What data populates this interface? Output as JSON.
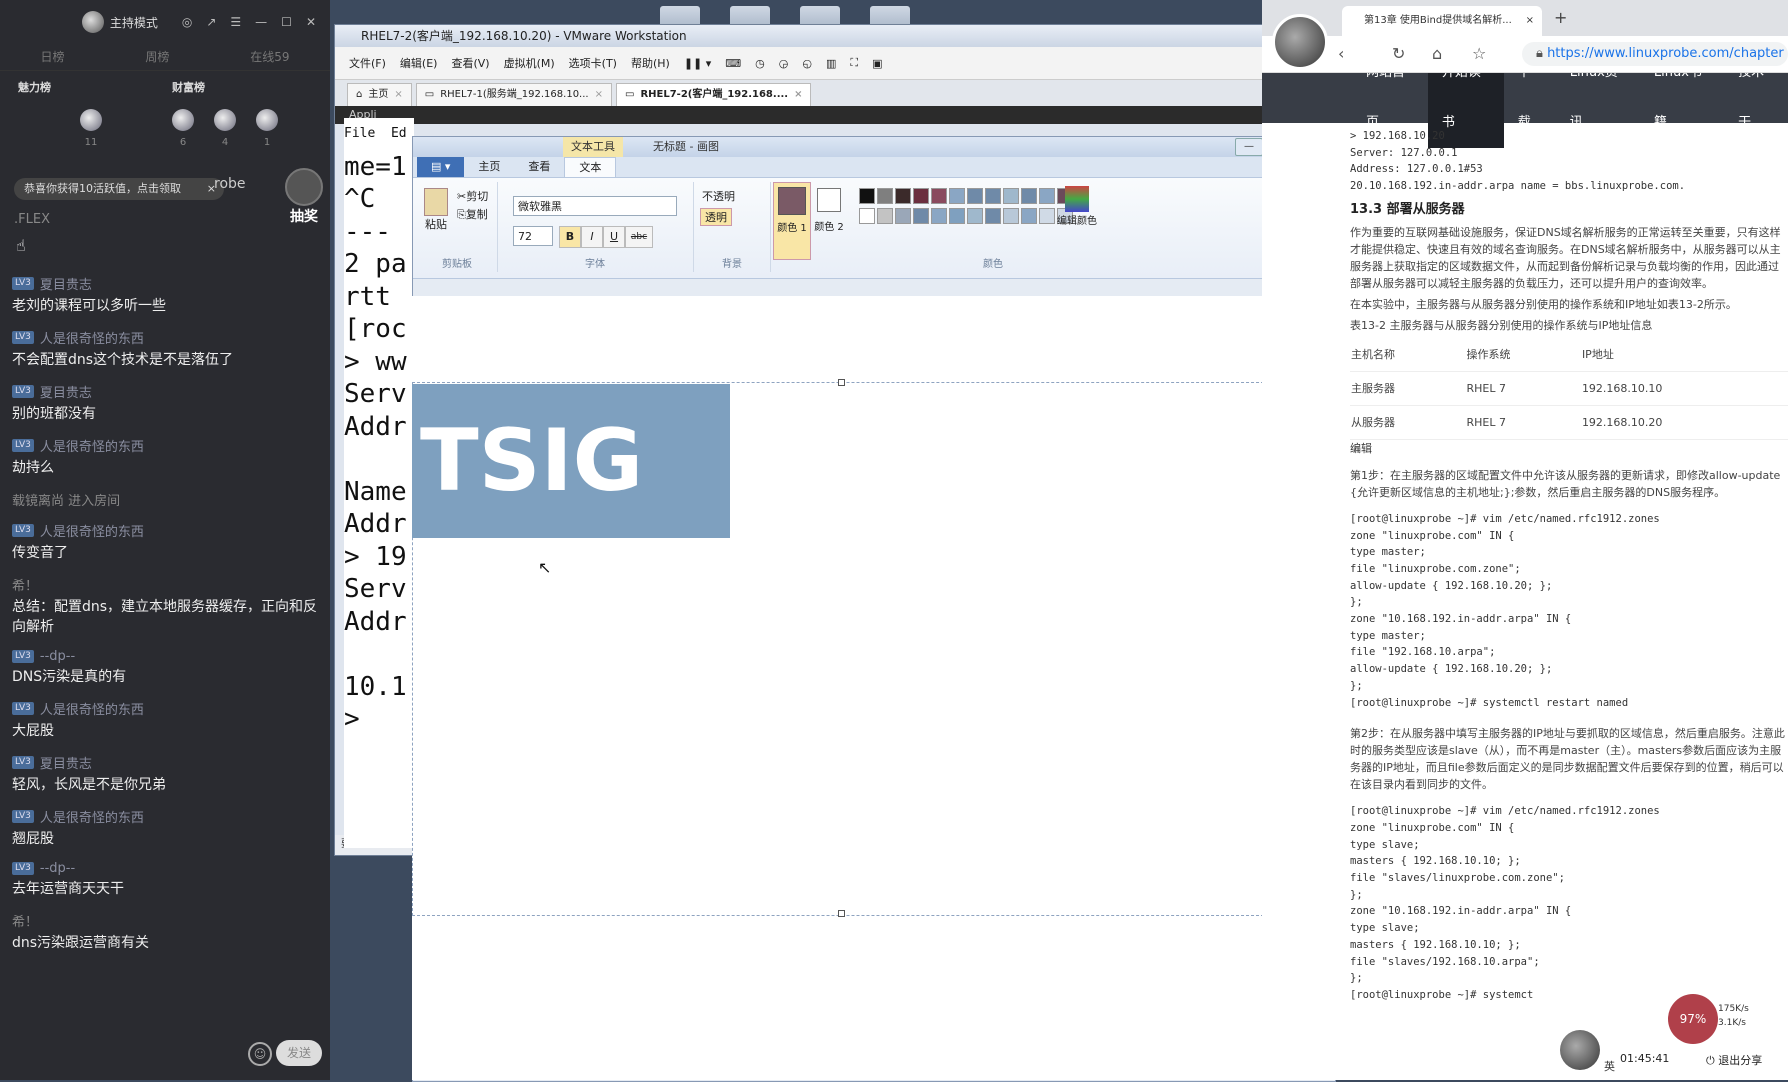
{
  "chat": {
    "host_label": "主持模式",
    "tabs": [
      "日榜",
      "周榜",
      "在线59"
    ],
    "rank_left_title": "魅力榜",
    "rank_right_title": "财富榜",
    "rank_icons": [
      {
        "count": "11"
      },
      {
        "count": "6"
      },
      {
        "count": "4"
      },
      {
        "count": "1"
      }
    ],
    "toast": "恭喜你获得10活跃值，点击领取",
    "toast_close": "×",
    "probe_text": "robe",
    "lottery": "抽奖",
    "flex_text": ".FLEX",
    "messages": [
      {
        "user": "夏目贵志",
        "lv": "LV3",
        "text": "老刘的课程可以多听一些"
      },
      {
        "user": "人是很奇怪的东西",
        "lv": "LV3",
        "text": "不会配置dns这个技术是不是落伍了"
      },
      {
        "user": "夏目贵志",
        "lv": "LV3",
        "text": "别的班都没有"
      },
      {
        "user": "人是很奇怪的东西",
        "lv": "LV3",
        "text": "劫持么"
      },
      {
        "user": "载镜离尚 进入房间",
        "lv": "",
        "text": ""
      },
      {
        "user": "人是很奇怪的东西",
        "lv": "LV3",
        "text": "传变音了"
      },
      {
        "user": "希！",
        "lv": "",
        "text": "总结：配置dns，建立本地服务器缓存，正向和反向解析"
      },
      {
        "user": "--dp--",
        "lv": "LV3",
        "text": "DNS污染是真的有"
      },
      {
        "user": "人是很奇怪的东西",
        "lv": "LV3",
        "text": "大屁股"
      },
      {
        "user": "夏目贵志",
        "lv": "LV3",
        "text": "轻风，长风是不是你兄弟"
      },
      {
        "user": "人是很奇怪的东西",
        "lv": "LV3",
        "text": "翘屁股"
      },
      {
        "user": "--dp--",
        "lv": "LV3",
        "text": "去年运营商天天干"
      },
      {
        "user": "希！",
        "lv": "",
        "text": "dns污染跟运营商有关"
      }
    ],
    "send_label": "发送"
  },
  "vmware": {
    "title": "RHEL7-2(客户端_192.168.10.20) - VMware Workstation",
    "menu": [
      "文件(F)",
      "编辑(E)",
      "查看(V)",
      "虚拟机(M)",
      "选项卡(T)",
      "帮助(H)"
    ],
    "tabs": [
      {
        "label": "主页"
      },
      {
        "label": "RHEL7-1(服务端_192.168.10..."
      },
      {
        "label": "RHEL7-2(客户端_192.168...."
      }
    ],
    "apps_label": "Appli",
    "terminal_lines": [
      "File  Ed",
      "me=1",
      "^C",
      "---",
      "2 pa",
      "rtt",
      "[roc",
      "> ww",
      "Serv",
      "Addr",
      "",
      "Name",
      "Addr",
      "> 19",
      "Serv",
      "Addr",
      "",
      "10.1",
      "> "
    ],
    "status_text": "要将输入定"
  },
  "paint": {
    "title": "无标题 - 画图",
    "context_tab": "文本工具",
    "ribbon_tabs": [
      "主页",
      "查看",
      "文本"
    ],
    "clipboard": {
      "paste": "粘贴",
      "cut": "剪切",
      "copy": "复制",
      "group": "剪贴板"
    },
    "font": {
      "name": "微软雅黑",
      "size": "72",
      "group": "字体",
      "bold": "B",
      "italic": "I",
      "underline": "U",
      "strike": "abc"
    },
    "background": {
      "opaque": "不透明",
      "transparent": "透明",
      "group": "背景"
    },
    "colors": {
      "color1": "颜色 1",
      "color2": "颜色 2",
      "edit": "编辑颜色",
      "group": "颜色",
      "palette": [
        "#111111",
        "#7f7f7f",
        "#3b2a2a",
        "#6b2f3f",
        "#8a4a5e",
        "#8aa6c4",
        "#6f8aa8",
        "#6f8aa8",
        "#9fb8cc",
        "#6f8aa8",
        "#8aa6c4",
        "#6b4a5a",
        "#ffffff",
        "#c3c3c3",
        "#9aa7b8",
        "#6f8aa8",
        "#8aa6c4",
        "#7fa0bf",
        "#9fb8cc",
        "#6f8aa8",
        "#b8c8d8",
        "#8aa6c4",
        "#d0dae6",
        "#cfd8e4"
      ]
    },
    "canvas_text": "TSIG",
    "canvas_text_bg": "#7ea0bf"
  },
  "browser": {
    "tab_title": "第13章 使用Bind提供域名解析...",
    "url": "https://www.linuxprobe.com/chapter",
    "site_nav": [
      {
        "label": "网站首页",
        "active": false
      },
      {
        "label": "开始读书",
        "active": true
      },
      {
        "label": "下载",
        "active": false
      },
      {
        "label": "Linux资讯",
        "active": false
      },
      {
        "label": "Linux书籍",
        "active": false
      },
      {
        "label": "技术干",
        "active": false
      }
    ],
    "article": {
      "top_lines": [
        "> 192.168.10.20",
        "Server: 127.0.0.1",
        "Address: 127.0.0.1#53",
        "20.10.168.192.in-addr.arpa name = bbs.linuxprobe.com."
      ],
      "heading": "13.3 部署从服务器",
      "para1": "作为重要的互联网基础设施服务，保证DNS域名解析服务的正常运转至关重要，只有这样才能提供稳定、快速且有效的域名查询服务。在DNS域名解析服务中，从服务器可以从主服务器上获取指定的区域数据文件，从而起到备份解析记录与负载均衡的作用，因此通过部署从服务器可以减轻主服务器的负载压力，还可以提升用户的查询效率。",
      "para2": "在本实验中，主服务器与从服务器分别使用的操作系统和IP地址如表13-2所示。",
      "table_caption": "表13-2        主服务器与从服务器分别使用的操作系统与IP地址信息",
      "table_head": [
        "主机名称",
        "操作系统",
        "IP地址"
      ],
      "table_rows": [
        [
          "主服务器",
          "RHEL 7",
          "192.168.10.10"
        ],
        [
          "从服务器",
          "RHEL 7",
          "192.168.10.20"
        ]
      ],
      "edit_label": "编辑",
      "step1": "第1步：在主服务器的区域配置文件中允许该从服务器的更新请求，即修改allow-update {允许更新区域信息的主机地址;};参数，然后重启主服务器的DNS服务程序。",
      "code1": [
        "[root@linuxprobe ~]# vim /etc/named.rfc1912.zones",
        "zone \"linuxprobe.com\" IN {",
        "type master;",
        "file \"linuxprobe.com.zone\";",
        "allow-update { 192.168.10.20; };",
        "};",
        "zone \"10.168.192.in-addr.arpa\" IN {",
        "type master;",
        "file \"192.168.10.arpa\";",
        "allow-update { 192.168.10.20; };",
        "};",
        "[root@linuxprobe ~]# systemctl restart named"
      ],
      "step2": "第2步：在从服务器中填写主服务器的IP地址与要抓取的区域信息，然后重启服务。注意此时的服务类型应该是slave（从），而不再是master（主）。masters参数后面应该为主服务器的IP地址，而且file参数后面定义的是同步数据配置文件后要保存到的位置，稍后可以在该目录内看到同步的文件。",
      "code2": [
        "[root@linuxprobe ~]# vim /etc/named.rfc1912.zones",
        "zone \"linuxprobe.com\" IN {",
        "type slave;",
        "masters { 192.168.10.10; };",
        "file \"slaves/linuxprobe.com.zone\";",
        "};",
        "zone \"10.168.192.in-addr.arpa\" IN {",
        "type slave;",
        "masters { 192.168.10.10; };",
        "file \"slaves/192.168.10.arpa\";",
        "};",
        "[root@linuxprobe ~]# systemct"
      ]
    },
    "badge": "97%",
    "net_up": "175K/s",
    "net_down": "3.1K/s",
    "time": "01:45:41",
    "share": "退出分享",
    "lang": "英"
  }
}
